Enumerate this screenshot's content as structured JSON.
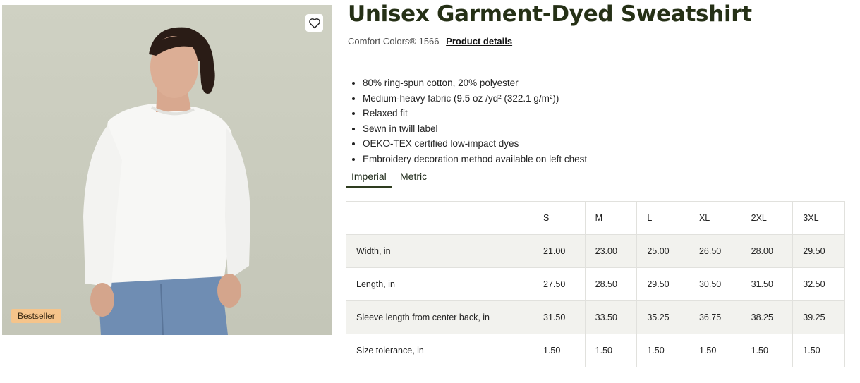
{
  "product": {
    "title": "Unisex Garment-Dyed Sweatshirt",
    "brand_code": "Comfort Colors® 1566",
    "details_link": "Product details",
    "badge": "Bestseller",
    "favorite_icon": "heart-outline-icon"
  },
  "features": [
    "80% ring-spun cotton, 20% polyester",
    "Medium-heavy fabric (9.5 oz /yd² (322.1 g/m²))",
    "Relaxed fit",
    "Sewn in twill label",
    "OEKO-TEX certified low-impact dyes",
    "Embroidery decoration method available on left chest"
  ],
  "tabs": {
    "imperial": "Imperial",
    "metric": "Metric",
    "active": "Imperial"
  },
  "size_table": {
    "sizes": [
      "S",
      "M",
      "L",
      "XL",
      "2XL",
      "3XL"
    ],
    "rows": [
      {
        "label": "Width, in",
        "values": [
          "21.00",
          "23.00",
          "25.00",
          "26.50",
          "28.00",
          "29.50"
        ]
      },
      {
        "label": "Length, in",
        "values": [
          "27.50",
          "28.50",
          "29.50",
          "30.50",
          "31.50",
          "32.50"
        ]
      },
      {
        "label": "Sleeve length from center back, in",
        "values": [
          "31.50",
          "33.50",
          "35.25",
          "36.75",
          "38.25",
          "39.25"
        ]
      },
      {
        "label": "Size tolerance, in",
        "values": [
          "1.50",
          "1.50",
          "1.50",
          "1.50",
          "1.50",
          "1.50"
        ]
      }
    ]
  },
  "colors": {
    "accent": "#253016",
    "badge": "#f5c48b",
    "row_shade": "#f2f2ee"
  }
}
